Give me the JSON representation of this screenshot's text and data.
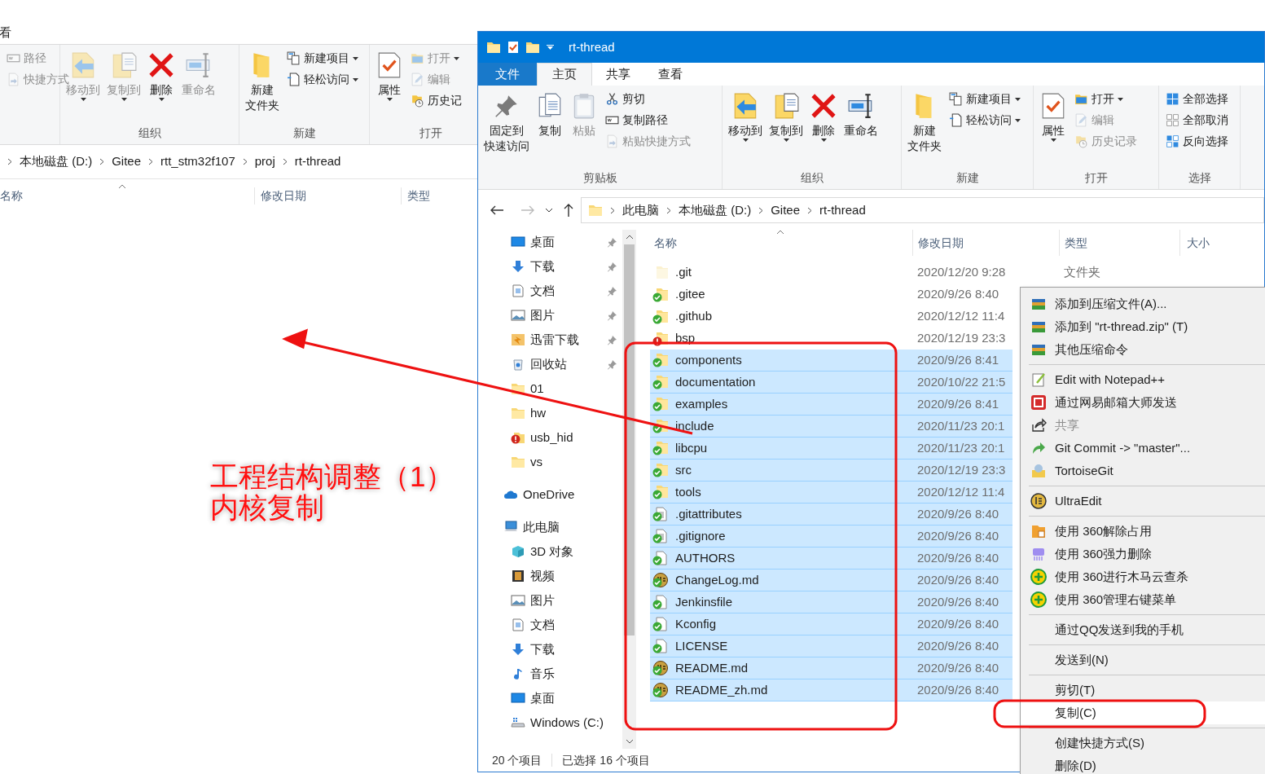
{
  "background_window": {
    "tab_fragment": "看",
    "ribbon_groups": [
      {
        "items": [
          {
            "label": "路径",
            "kind": "small",
            "disabled": true,
            "dropdown": false
          },
          {
            "label": "快捷方式",
            "kind": "small",
            "disabled": true,
            "dropdown": false
          }
        ]
      },
      {
        "label": "组织",
        "items": [
          {
            "label": "移动到",
            "kind": "large",
            "disabled": true,
            "dropdown": true
          },
          {
            "label": "复制到",
            "kind": "large",
            "disabled": true,
            "dropdown": true
          },
          {
            "label": "删除",
            "kind": "large",
            "disabled": false,
            "dropdown": true
          },
          {
            "label": "重命名",
            "kind": "large",
            "disabled": true,
            "dropdown": false
          }
        ]
      },
      {
        "label": "新建",
        "items": [
          {
            "lines": [
              "新建",
              "文件夹"
            ],
            "kind": "large",
            "disabled": false,
            "dropdown": false
          },
          {
            "label": "新建项目",
            "kind": "small",
            "disabled": false,
            "dropdown": true
          },
          {
            "label": "轻松访问",
            "kind": "small",
            "disabled": false,
            "dropdown": true
          }
        ]
      },
      {
        "label": "打开",
        "items": [
          {
            "label": "属性",
            "kind": "large",
            "disabled": false,
            "dropdown": true
          },
          {
            "label": "打开",
            "kind": "small",
            "disabled": true,
            "dropdown": true
          },
          {
            "label": "编辑",
            "kind": "small",
            "disabled": true,
            "dropdown": false
          },
          {
            "label": "历史记",
            "kind": "small",
            "disabled": false,
            "dropdown": false
          }
        ]
      }
    ],
    "breadcrumb": [
      "本地磁盘 (D:)",
      "Gitee",
      "rtt_stm32f107",
      "proj",
      "rt-thread"
    ],
    "columns": [
      "名称",
      "修改日期",
      "类型"
    ]
  },
  "window": {
    "title": "rt-thread",
    "tabs": [
      {
        "label": "文件",
        "kind": "file",
        "selected": false
      },
      {
        "label": "主页",
        "kind": "tab",
        "selected": true
      },
      {
        "label": "共享",
        "kind": "tab",
        "selected": false
      },
      {
        "label": "查看",
        "kind": "tab",
        "selected": false
      }
    ],
    "ribbon_groups": [
      {
        "label": "剪贴板",
        "items": [
          {
            "lines": [
              "固定到",
              "快速访问"
            ],
            "kind": "large",
            "disabled": false,
            "dropdown": false
          },
          {
            "label": "复制",
            "kind": "large",
            "disabled": false,
            "dropdown": false
          },
          {
            "label": "粘贴",
            "kind": "large",
            "disabled": true,
            "dropdown": false
          },
          {
            "label": "剪切",
            "kind": "small",
            "disabled": false,
            "dropdown": false
          },
          {
            "label": "复制路径",
            "kind": "small",
            "disabled": false,
            "dropdown": false
          },
          {
            "label": "粘贴快捷方式",
            "kind": "small",
            "disabled": true,
            "dropdown": false
          }
        ]
      },
      {
        "label": "组织",
        "items": [
          {
            "label": "移动到",
            "kind": "large",
            "disabled": false,
            "dropdown": true
          },
          {
            "label": "复制到",
            "kind": "large",
            "disabled": false,
            "dropdown": true
          },
          {
            "label": "删除",
            "kind": "large",
            "disabled": false,
            "dropdown": true
          },
          {
            "label": "重命名",
            "kind": "large",
            "disabled": false,
            "dropdown": false
          }
        ]
      },
      {
        "label": "新建",
        "items": [
          {
            "lines": [
              "新建",
              "文件夹"
            ],
            "kind": "large",
            "disabled": false,
            "dropdown": false
          },
          {
            "label": "新建项目",
            "kind": "small",
            "disabled": false,
            "dropdown": true
          },
          {
            "label": "轻松访问",
            "kind": "small",
            "disabled": false,
            "dropdown": true
          }
        ]
      },
      {
        "label": "打开",
        "items": [
          {
            "label": "属性",
            "kind": "large",
            "disabled": false,
            "dropdown": true
          },
          {
            "label": "打开",
            "kind": "small",
            "disabled": false,
            "dropdown": true
          },
          {
            "label": "编辑",
            "kind": "small",
            "disabled": true,
            "dropdown": false
          },
          {
            "label": "历史记录",
            "kind": "small",
            "disabled": true,
            "dropdown": false
          }
        ]
      },
      {
        "label": "选择",
        "items": [
          {
            "label": "全部选择",
            "kind": "small",
            "disabled": false,
            "dropdown": false
          },
          {
            "label": "全部取消",
            "kind": "small",
            "disabled": false,
            "dropdown": false
          },
          {
            "label": "反向选择",
            "kind": "small",
            "disabled": false,
            "dropdown": false
          }
        ]
      }
    ],
    "breadcrumb": [
      "此电脑",
      "本地磁盘 (D:)",
      "Gitee",
      "rt-thread"
    ],
    "quick_access": [
      {
        "label": "桌面",
        "pinned": true
      },
      {
        "label": "下载",
        "pinned": true
      },
      {
        "label": "文档",
        "pinned": true
      },
      {
        "label": "图片",
        "pinned": true
      },
      {
        "label": "迅雷下载",
        "pinned": true
      },
      {
        "label": "回收站",
        "pinned": true
      },
      {
        "label": "01",
        "pinned": false
      },
      {
        "label": "hw",
        "pinned": false
      },
      {
        "label": "usb_hid",
        "pinned": false
      },
      {
        "label": "vs",
        "pinned": false
      }
    ],
    "locations": [
      {
        "label": "OneDrive"
      },
      {
        "label": "此电脑",
        "children": [
          {
            "label": "3D 对象"
          },
          {
            "label": "视频"
          },
          {
            "label": "图片"
          },
          {
            "label": "文档"
          },
          {
            "label": "下载"
          },
          {
            "label": "音乐"
          },
          {
            "label": "桌面"
          },
          {
            "label": "Windows (C:)"
          }
        ]
      }
    ],
    "columns": [
      "名称",
      "修改日期",
      "类型",
      "大小"
    ],
    "rows": [
      {
        "name": ".git",
        "date": "2020/12/20 9:28",
        "type": "文件夹",
        "kind": "folder",
        "hidden": true,
        "synced": false,
        "conflict": false,
        "selected": false
      },
      {
        "name": ".gitee",
        "date": "2020/9/26 8:40",
        "kind": "folder",
        "hidden": false,
        "synced": true,
        "conflict": false,
        "selected": false
      },
      {
        "name": ".github",
        "date": "2020/12/12 11:4",
        "kind": "folder",
        "hidden": false,
        "synced": true,
        "conflict": false,
        "selected": false
      },
      {
        "name": "bsp",
        "date": "2020/12/19 23:3",
        "kind": "folder",
        "hidden": false,
        "synced": false,
        "conflict": true,
        "selected": false
      },
      {
        "name": "components",
        "date": "2020/9/26 8:41",
        "kind": "folder",
        "hidden": false,
        "synced": true,
        "conflict": false,
        "selected": true
      },
      {
        "name": "documentation",
        "date": "2020/10/22 21:5",
        "kind": "folder",
        "hidden": false,
        "synced": true,
        "conflict": false,
        "selected": true
      },
      {
        "name": "examples",
        "date": "2020/9/26 8:41",
        "kind": "folder",
        "hidden": false,
        "synced": true,
        "conflict": false,
        "selected": true
      },
      {
        "name": "include",
        "date": "2020/11/23 20:1",
        "kind": "folder",
        "hidden": false,
        "synced": true,
        "conflict": false,
        "selected": true
      },
      {
        "name": "libcpu",
        "date": "2020/11/23 20:1",
        "kind": "folder",
        "hidden": false,
        "synced": true,
        "conflict": false,
        "selected": true
      },
      {
        "name": "src",
        "date": "2020/12/19 23:3",
        "kind": "folder",
        "hidden": false,
        "synced": true,
        "conflict": false,
        "selected": true
      },
      {
        "name": "tools",
        "date": "2020/12/12 11:4",
        "kind": "folder",
        "hidden": false,
        "synced": true,
        "conflict": false,
        "selected": true
      },
      {
        "name": ".gitattributes",
        "date": "2020/9/26 8:40",
        "kind": "text",
        "hidden": false,
        "synced": true,
        "conflict": false,
        "selected": true
      },
      {
        "name": ".gitignore",
        "date": "2020/9/26 8:40",
        "kind": "text",
        "hidden": false,
        "synced": true,
        "conflict": false,
        "selected": true
      },
      {
        "name": "AUTHORS",
        "date": "2020/9/26 8:40",
        "kind": "file",
        "hidden": false,
        "synced": true,
        "conflict": false,
        "selected": true
      },
      {
        "name": "ChangeLog.md",
        "date": "2020/9/26 8:40",
        "kind": "doc",
        "hidden": false,
        "synced": true,
        "conflict": false,
        "selected": true
      },
      {
        "name": "Jenkinsfile",
        "date": "2020/9/26 8:40",
        "kind": "file",
        "hidden": false,
        "synced": true,
        "conflict": false,
        "selected": true
      },
      {
        "name": "Kconfig",
        "date": "2020/9/26 8:40",
        "kind": "file",
        "hidden": false,
        "synced": true,
        "conflict": false,
        "selected": true
      },
      {
        "name": "LICENSE",
        "date": "2020/9/26 8:40",
        "kind": "file",
        "hidden": false,
        "synced": true,
        "conflict": false,
        "selected": true
      },
      {
        "name": "README.md",
        "date": "2020/9/26 8:40",
        "kind": "doc",
        "hidden": false,
        "synced": true,
        "conflict": false,
        "selected": true
      },
      {
        "name": "README_zh.md",
        "date": "2020/9/26 8:40",
        "kind": "doc",
        "hidden": false,
        "synced": true,
        "conflict": false,
        "selected": true
      }
    ],
    "status_bar": {
      "count": "20 个项目",
      "selection": "已选择 16 个项目"
    }
  },
  "context_menu": {
    "items": [
      {
        "kind": "item",
        "label": "添加到压缩文件(A)...",
        "disabled": false,
        "selected": false
      },
      {
        "kind": "item",
        "label": "添加到 \"rt-thread.zip\" (T)",
        "disabled": false,
        "selected": false
      },
      {
        "kind": "item",
        "label": "其他压缩命令",
        "disabled": false,
        "selected": false
      },
      {
        "kind": "separator"
      },
      {
        "kind": "item",
        "label": "Edit with Notepad++",
        "disabled": false,
        "selected": false
      },
      {
        "kind": "item",
        "label": "通过网易邮箱大师发送",
        "disabled": false,
        "selected": false
      },
      {
        "kind": "item",
        "label": "共享",
        "disabled": true,
        "selected": false
      },
      {
        "kind": "item",
        "label": "Git Commit -> \"master\"...",
        "disabled": false,
        "selected": false
      },
      {
        "kind": "item",
        "label": "TortoiseGit",
        "disabled": false,
        "selected": false
      },
      {
        "kind": "separator"
      },
      {
        "kind": "item",
        "label": "UltraEdit",
        "disabled": false,
        "selected": false
      },
      {
        "kind": "separator"
      },
      {
        "kind": "item",
        "label": "使用 360解除占用",
        "disabled": false,
        "selected": false
      },
      {
        "kind": "item",
        "label": "使用 360强力删除",
        "disabled": false,
        "selected": false
      },
      {
        "kind": "item",
        "label": "使用 360进行木马云查杀",
        "disabled": false,
        "selected": false
      },
      {
        "kind": "item",
        "label": "使用 360管理右键菜单",
        "disabled": false,
        "selected": false
      },
      {
        "kind": "separator"
      },
      {
        "kind": "item",
        "label": "通过QQ发送到我的手机",
        "disabled": false,
        "selected": false
      },
      {
        "kind": "separator"
      },
      {
        "kind": "item",
        "label": "发送到(N)",
        "disabled": false,
        "selected": false
      },
      {
        "kind": "separator"
      },
      {
        "kind": "item",
        "label": "剪切(T)",
        "disabled": false,
        "selected": false
      },
      {
        "kind": "item",
        "label": "复制(C)",
        "disabled": false,
        "selected": true
      },
      {
        "kind": "separator"
      },
      {
        "kind": "item",
        "label": "创建快捷方式(S)",
        "disabled": false,
        "selected": false
      },
      {
        "kind": "item",
        "label": "删除(D)",
        "disabled": false,
        "selected": false
      }
    ]
  },
  "annotation": {
    "lines": [
      "工程结构调整（1）",
      "内核复制"
    ]
  }
}
